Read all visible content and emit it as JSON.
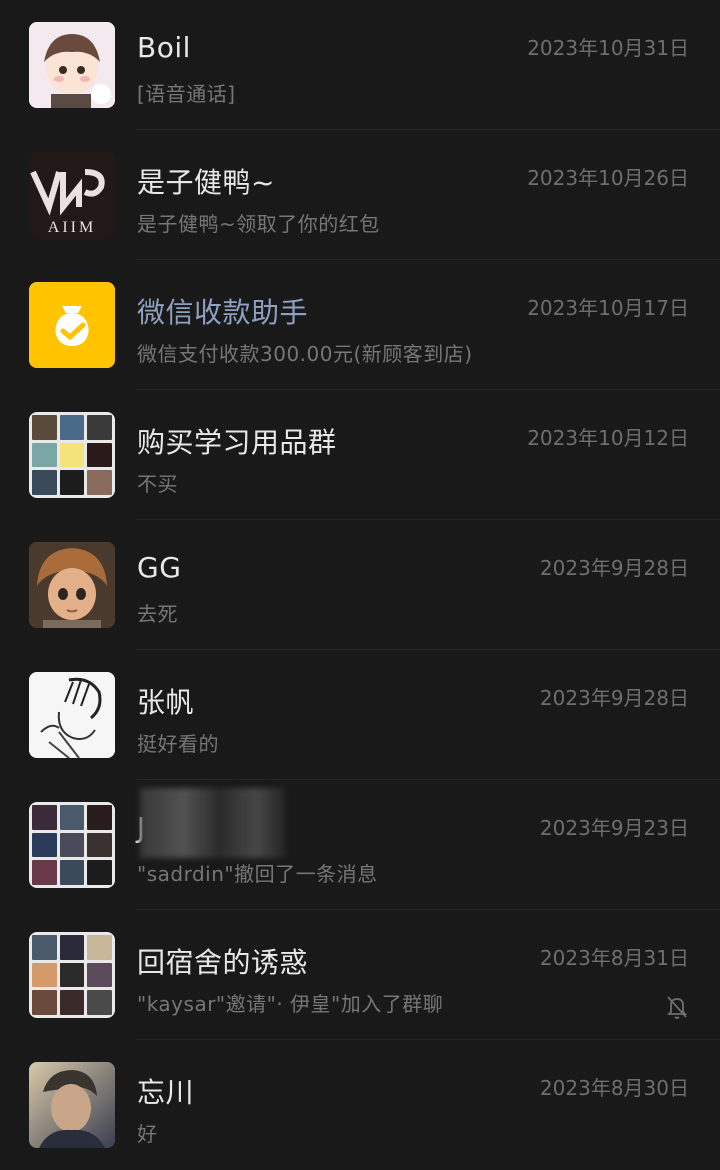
{
  "chats": [
    {
      "name": "Boil",
      "preview": "[语音通话]",
      "time": "2023年10月31日",
      "avatar_icon": "anime-girl-avatar-icon"
    },
    {
      "name": "是子健鸭~",
      "preview": "是子健鸭~领取了你的红包",
      "time": "2023年10月26日",
      "avatar_icon": "aiim-logo-avatar-icon"
    },
    {
      "name": "微信收款助手",
      "preview": "微信支付收款300.00元(新顾客到店)",
      "time": "2023年10月17日",
      "avatar_icon": "money-bag-icon"
    },
    {
      "name": "购买学习用品群",
      "preview": "不买",
      "time": "2023年10月12日",
      "avatar_icon": "group-grid-avatar-icon"
    },
    {
      "name": "GG",
      "preview": "去死",
      "time": "2023年9月28日",
      "avatar_icon": "anime-boy-avatar-icon"
    },
    {
      "name": "张帆",
      "preview": "挺好看的",
      "time": "2023年9月28日",
      "avatar_icon": "manga-sketch-avatar-icon"
    },
    {
      "name": "\"sadrdin\"撤回了一条消息",
      "preview": "\"sadrdin\"撤回了一条消息",
      "time": "2023年9月23日",
      "avatar_icon": "group-grid-avatar-icon",
      "name_visible": "J"
    },
    {
      "name": "回宿舍的诱惑",
      "preview": "\"kaysar\"邀请\"· 伊皇\"加入了群聊",
      "time": "2023年8月31日",
      "avatar_icon": "group-grid-avatar-icon",
      "muted": true
    },
    {
      "name": "忘川",
      "preview": "好",
      "time": "2023年8月30日",
      "avatar_icon": "photo-avatar-icon"
    }
  ],
  "colors": {
    "background": "#191919",
    "official_name": "#8ea1c0",
    "pay_yellow": "#ffc300"
  }
}
